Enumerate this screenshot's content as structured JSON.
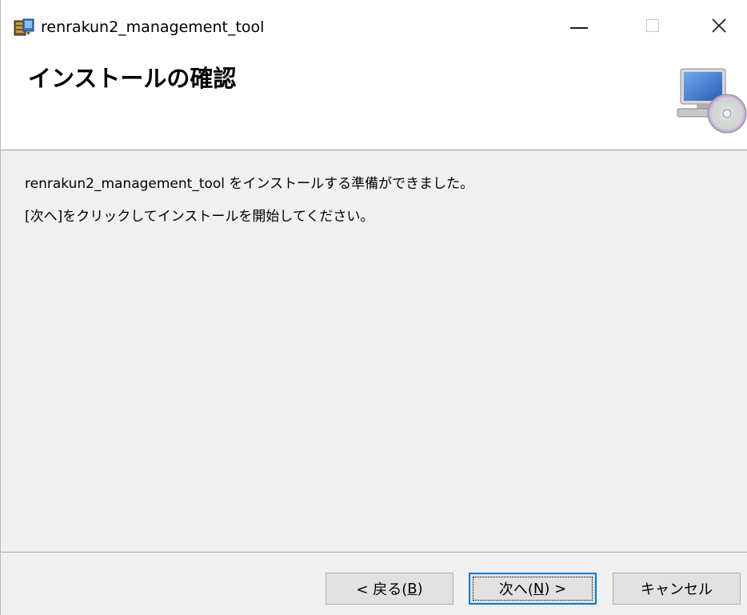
{
  "window": {
    "title": "renrakun2_management_tool",
    "minimize_glyph": "—",
    "close_glyph": "✕"
  },
  "header": {
    "title": "インストールの確認",
    "icon": "computer-cd-icon"
  },
  "content": {
    "line1": "renrakun2_management_tool をインストールする準備ができました。",
    "line2": "[次へ]をクリックしてインストールを開始してください。"
  },
  "buttons": {
    "back_prefix": "< 戻る(",
    "back_key": "B",
    "back_suffix": ")",
    "next_prefix": "次へ(",
    "next_key": "N",
    "next_suffix": ") >",
    "cancel": "キャンセル"
  },
  "colors": {
    "focus_border": "#0078d7",
    "dialog_bg": "#f0f0f0",
    "header_bg": "#ffffff"
  }
}
